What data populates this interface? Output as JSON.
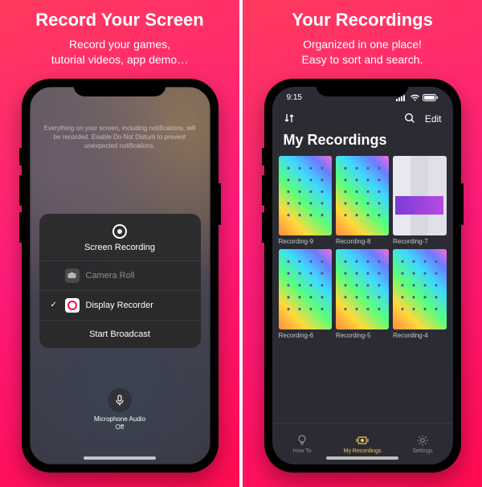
{
  "left": {
    "title": "Record Your Screen",
    "subtitle": "Record your games,\ntutorial videos, app demo…",
    "disclaimer": "Everything on your screen, including notifications, will be recorded. Enable Do Not Disturb to prevent unexpected notifications.",
    "sheet": {
      "header": "Screen Recording",
      "camera_roll": "Camera Roll",
      "display_recorder": "Display Recorder",
      "start": "Start Broadcast"
    },
    "mic": {
      "label": "Microphone Audio",
      "state": "Off"
    }
  },
  "right": {
    "title": "Your Recordings",
    "subtitle": "Organized in one place!\nEasy to sort and search.",
    "status": {
      "time": "9:15"
    },
    "toolbar": {
      "edit": "Edit",
      "section": "My Recordings"
    },
    "recordings": [
      {
        "label": "Recording-9",
        "kind": "home"
      },
      {
        "label": "Recording-8",
        "kind": "home"
      },
      {
        "label": "Recording-7",
        "kind": "shots"
      },
      {
        "label": "Recording-6",
        "kind": "home"
      },
      {
        "label": "Recording-5",
        "kind": "home"
      },
      {
        "label": "Recording-4",
        "kind": "home"
      }
    ],
    "tabs": {
      "howto": "How To",
      "recordings": "My Recordings",
      "settings": "Settings"
    }
  }
}
